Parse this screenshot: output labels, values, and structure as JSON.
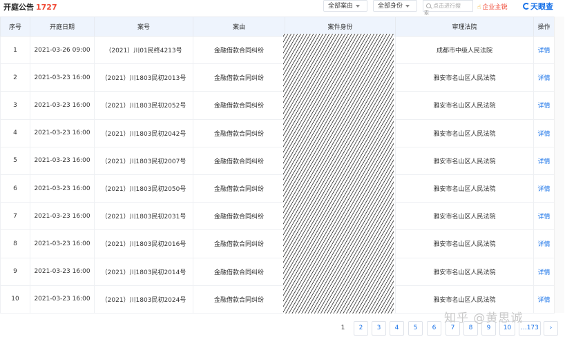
{
  "header": {
    "title": "开庭公告",
    "count": "1727",
    "filter_cause": "全部案由",
    "filter_role": "全部身份",
    "search_placeholder": "点击进行搜",
    "search_sub": "索",
    "enterprise_label": "企业主锐",
    "logo_text": "天眼查"
  },
  "table": {
    "columns": [
      "序号",
      "开庭日期",
      "案号",
      "案由",
      "案件身份",
      "审理法院",
      "操作"
    ],
    "rows": [
      {
        "no": "1",
        "date": "2021-03-26 09:00",
        "case_no": "（2021）川01民终4213号",
        "cause": "金融借款合同纠纷",
        "court": "成都市中级人民法院",
        "action": "详情"
      },
      {
        "no": "2",
        "date": "2021-03-23 16:00",
        "case_no": "（2021）川1803民初2013号",
        "cause": "金融借款合同纠纷",
        "court": "雅安市名山区人民法院",
        "action": "详情"
      },
      {
        "no": "3",
        "date": "2021-03-23 16:00",
        "case_no": "（2021）川1803民初2052号",
        "cause": "金融借款合同纠纷",
        "court": "雅安市名山区人民法院",
        "action": "详情"
      },
      {
        "no": "4",
        "date": "2021-03-23 16:00",
        "case_no": "（2021）川1803民初2042号",
        "cause": "金融借款合同纠纷",
        "court": "雅安市名山区人民法院",
        "action": "详情"
      },
      {
        "no": "5",
        "date": "2021-03-23 16:00",
        "case_no": "（2021）川1803民初2007号",
        "cause": "金融借款合同纠纷",
        "court": "雅安市名山区人民法院",
        "action": "详情"
      },
      {
        "no": "6",
        "date": "2021-03-23 16:00",
        "case_no": "（2021）川1803民初2050号",
        "cause": "金融借款合同纠纷",
        "court": "雅安市名山区人民法院",
        "action": "详情"
      },
      {
        "no": "7",
        "date": "2021-03-23 16:00",
        "case_no": "（2021）川1803民初2031号",
        "cause": "金融借款合同纠纷",
        "court": "雅安市名山区人民法院",
        "action": "详情"
      },
      {
        "no": "8",
        "date": "2021-03-23 16:00",
        "case_no": "（2021）川1803民初2016号",
        "cause": "金融借款合同纠纷",
        "court": "雅安市名山区人民法院",
        "action": "详情"
      },
      {
        "no": "9",
        "date": "2021-03-23 16:00",
        "case_no": "（2021）川1803民初2014号",
        "cause": "金融借款合同纠纷",
        "court": "雅安市名山区人民法院",
        "action": "详情"
      },
      {
        "no": "10",
        "date": "2021-03-23 16:00",
        "case_no": "（2021）川1803民初2024号",
        "cause": "金融借款合同纠纷",
        "court": "雅安市名山区人民法院",
        "action": "详情"
      }
    ]
  },
  "pagination": {
    "pages": [
      "1",
      "2",
      "3",
      "4",
      "5",
      "6",
      "7",
      "8",
      "9",
      "10",
      "...173",
      "›"
    ],
    "current": "1"
  },
  "watermark": "知乎 @黄思诚",
  "colors": {
    "accent": "#1a73e8",
    "count": "#f04a36",
    "header_bg": "#eef4fd"
  }
}
